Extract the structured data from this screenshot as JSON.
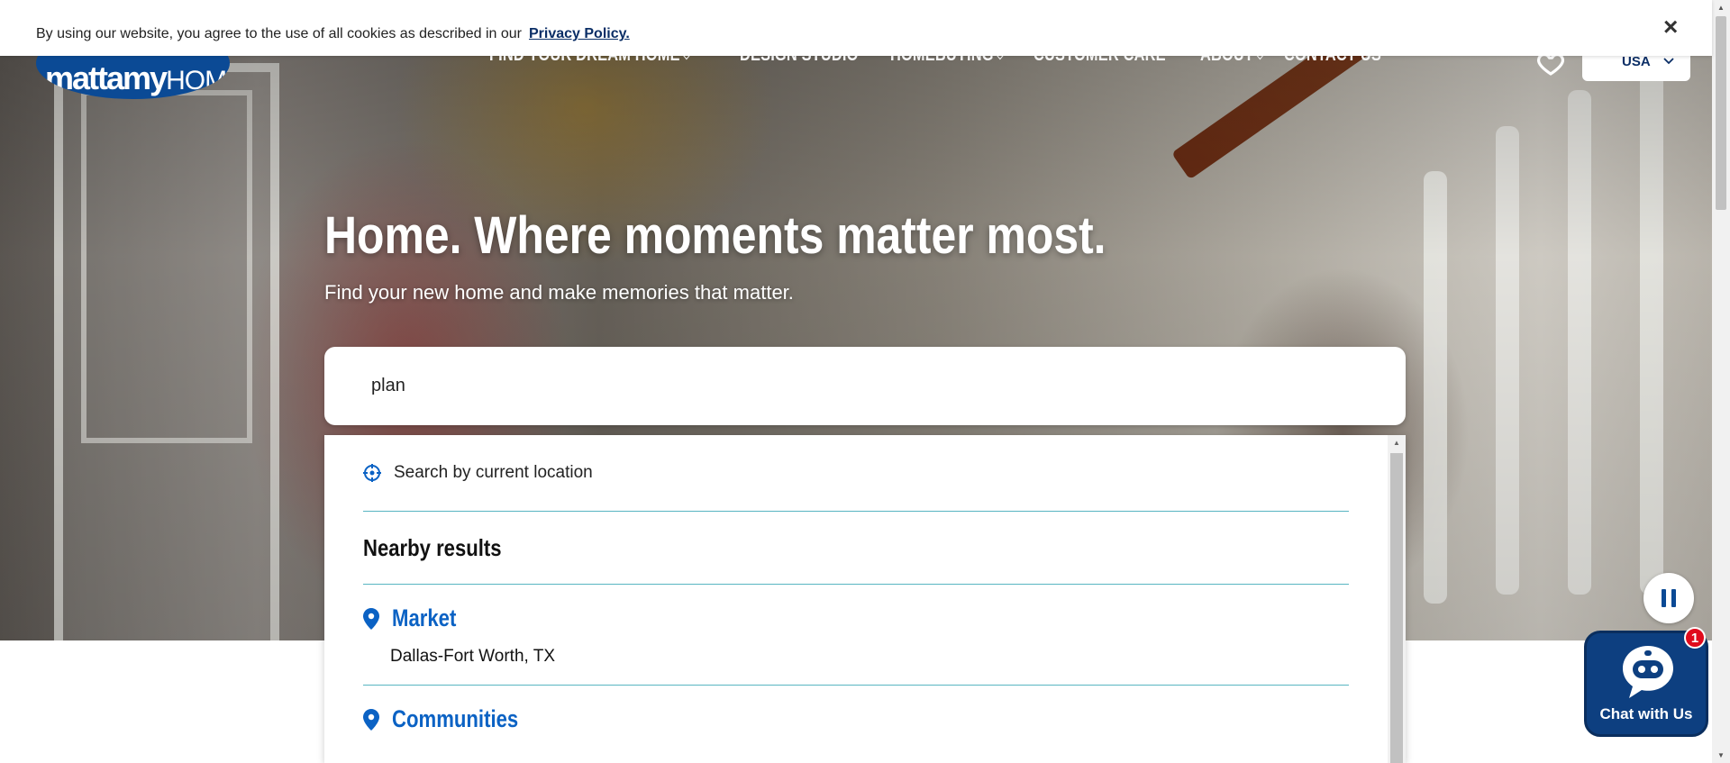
{
  "cookie_banner": {
    "text": "By using our website, you agree to the use of all cookies as described in our",
    "link_label": "Privacy Policy.",
    "close_label": "×"
  },
  "brand": {
    "logo_main": "mattamy",
    "logo_sub": "HOMES",
    "primary_color": "#0b4a95",
    "accent_color": "#0b62c4"
  },
  "nav": {
    "items": [
      {
        "label": "FIND YOUR DREAM HOME",
        "dropdown": true
      },
      {
        "label": "DESIGN STUDIO",
        "dropdown": false
      },
      {
        "label": "HOMEBUYING",
        "dropdown": true
      },
      {
        "label": "CUSTOMER CARE",
        "dropdown": false
      },
      {
        "label": "ABOUT",
        "dropdown": true
      },
      {
        "label": "CONTACT US",
        "dropdown": false
      }
    ],
    "country": "USA",
    "favorites_icon": "heart-icon"
  },
  "hero": {
    "headline": "Home. Where moments matter most.",
    "subheadline": "Find your new home and make memories that matter."
  },
  "search": {
    "value": "plan",
    "current_location_label": "Search by current location",
    "nearby_label": "Nearby results",
    "groups": [
      {
        "title": "Market",
        "items": [
          "Dallas-Fort Worth, TX"
        ]
      },
      {
        "title": "Communities",
        "items": []
      }
    ]
  },
  "chat": {
    "label": "Chat with Us",
    "badge_count": "1"
  }
}
